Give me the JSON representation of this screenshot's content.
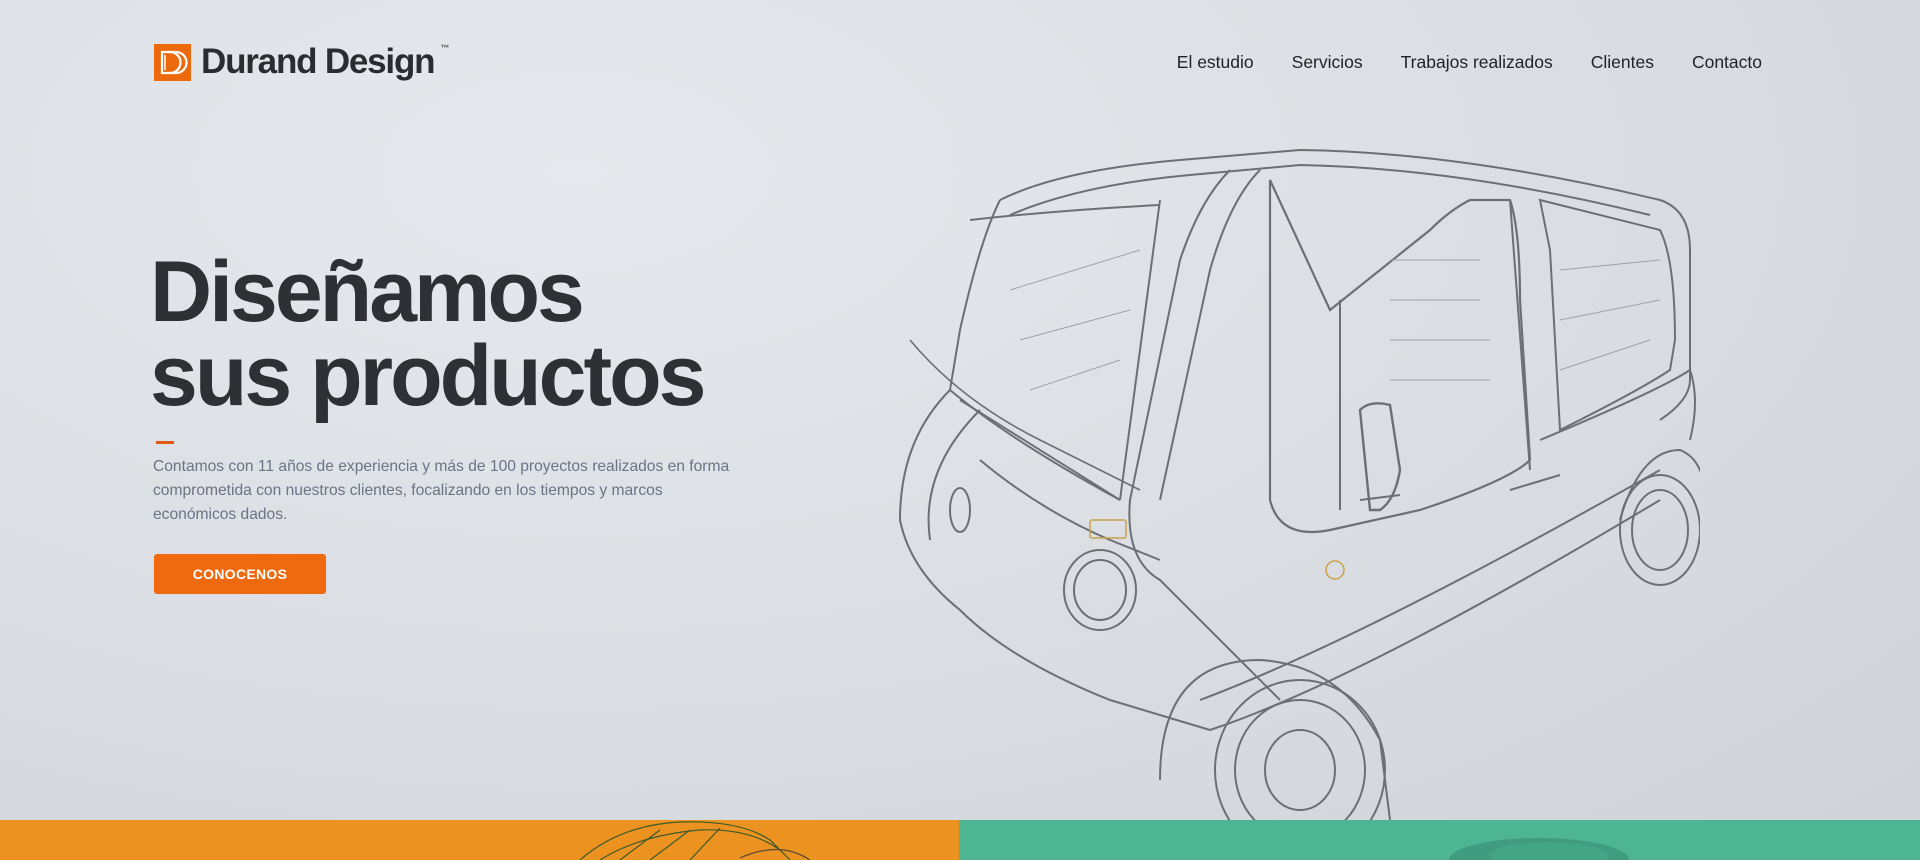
{
  "brand": {
    "name": "Durand Design",
    "tm": "™",
    "accent_color": "#ec6a0c"
  },
  "nav": {
    "items": [
      {
        "label": "El estudio"
      },
      {
        "label": "Servicios"
      },
      {
        "label": "Trabajos realizados"
      },
      {
        "label": "Clientes"
      },
      {
        "label": "Contacto"
      }
    ]
  },
  "hero": {
    "title_line1": "Diseñamos",
    "title_line2": "sus productos",
    "description": "Contamos con 11 años de experiencia y más de 100 proyectos realizados en forma comprometida con nuestros clientes, focalizando en los tiempos y marcos económicos dados.",
    "cta_label": "CONOCENOS",
    "illustration_icon": "van-wireframe-icon"
  },
  "panels": {
    "left_color": "#ec9220",
    "right_color": "#4db592"
  }
}
